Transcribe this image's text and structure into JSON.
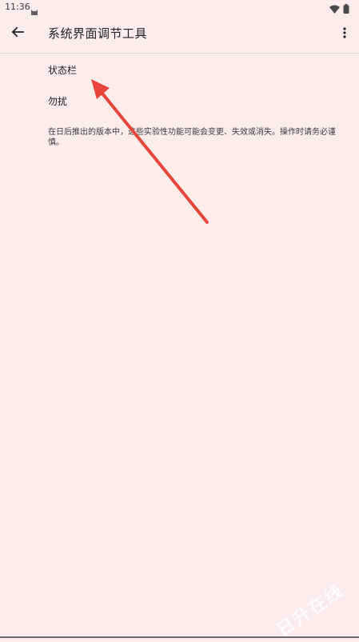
{
  "status_bar": {
    "time": "11:36",
    "app_icon": "android-cat-icon",
    "wifi_icon": "wifi-icon",
    "battery_icon": "battery-icon"
  },
  "app_bar": {
    "back_icon": "arrow-back-icon",
    "title": "系统界面调节工具",
    "overflow_icon": "more-vert-icon"
  },
  "items": [
    {
      "label": "状态栏"
    },
    {
      "label": "勿扰"
    }
  ],
  "footer_note": "在日后推出的版本中，这些实验性功能可能会变更、失效或消失。操作时请务必谨慎。",
  "annotation": {
    "arrow_color": "#e8463a"
  },
  "watermark": "日升在线",
  "colors": {
    "background": "#fcecea",
    "text": "#202124"
  }
}
